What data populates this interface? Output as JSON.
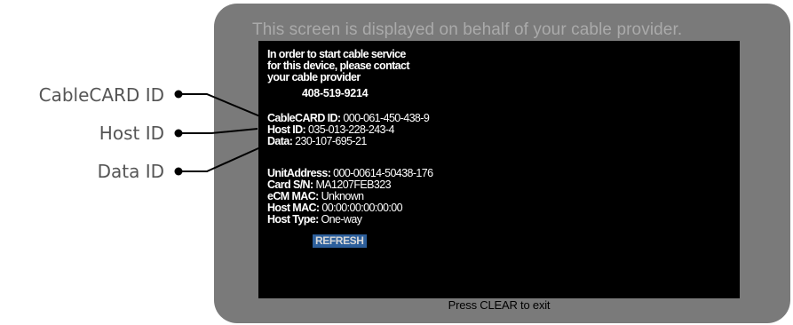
{
  "callouts": [
    {
      "label": "CableCARD ID"
    },
    {
      "label": "Host ID"
    },
    {
      "label": "Data ID"
    }
  ],
  "screen": {
    "banner": "This screen is displayed on behalf of your cable provider.",
    "instructions": [
      "In order to start cable service",
      "for this device, please contact",
      "your cable provider"
    ],
    "phone": "408-519-9214",
    "ids": [
      {
        "label": "CableCARD ID:",
        "value": "000-061-450-438-9"
      },
      {
        "label": "Host ID:",
        "value": "035-013-228-243-4"
      },
      {
        "label": "Data:",
        "value": "230-107-695-21"
      }
    ],
    "details": [
      {
        "label": "UnitAddress:",
        "value": "000-00614-50438-176"
      },
      {
        "label": "Card S/N:",
        "value": "MA1207FEB323"
      },
      {
        "label": "eCM MAC:",
        "value": "Unknown"
      },
      {
        "label": "Host MAC:",
        "value": "00:00:00:00:00:00"
      },
      {
        "label": "Host Type:",
        "value": "One-way"
      }
    ],
    "refresh_label": "REFRESH",
    "footer": "Press CLEAR to exit"
  },
  "colors": {
    "frame": "#7a7a7a",
    "panel": "#000000",
    "highlight": "#2d5f9b"
  }
}
